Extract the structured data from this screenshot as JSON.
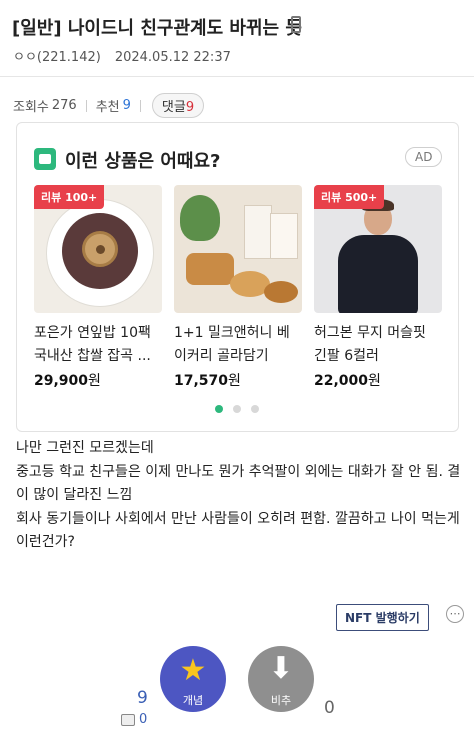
{
  "post": {
    "title": "[일반] 나이드니 친구관계도 바뀌는 듯",
    "author": "ㅇㅇ(221.142)",
    "date": "2024.05.12 22:37",
    "views_label": "조회수",
    "views": "276",
    "recommend_label": "추천",
    "recommend": "9",
    "comments_label": "댓글",
    "comments": "9",
    "body": [
      "나만 그런진 모르겠는데",
      "중고등 학교 친구들은 이제 만나도 뭔가 추억팔이 외에는 대화가 잘 안 됨. 결이 많이 달라진 느낌",
      "회사 동기들이나 사회에서 만난 사람들이 오히려 편함. 깔끔하고 나이 먹는게 이런건가?"
    ]
  },
  "ad": {
    "heading": "이런 상품은 어때요?",
    "tag": "AD",
    "products": [
      {
        "badge": "리뷰 100+",
        "name": "포은가 연잎밥 10팩 국내산 찹쌀 잡곡 ...",
        "price": "29,900",
        "unit": "원"
      },
      {
        "badge": "",
        "name": "1+1 밀크앤허니 베이커리 골라담기",
        "price": "17,570",
        "unit": "원"
      },
      {
        "badge": "리뷰 500+",
        "name": "허그본 무지 머슬핏 긴팔 6컬러",
        "price": "22,000",
        "unit": "원"
      }
    ],
    "active_page": 1,
    "pages": 3
  },
  "actions": {
    "nft_label": "NFT 발행하기",
    "up_label": "개념",
    "down_label": "비추",
    "up_count": "9",
    "up_sub_count": "0",
    "down_count": "0"
  },
  "colors": {
    "accent_blue": "#4d56c2",
    "badge_red": "#e8404a",
    "active_dot": "#2db87d",
    "star": "#f9c51e"
  },
  "icons": [
    "mobile-icon",
    "store-logo-icon",
    "share-icon",
    "star-icon",
    "down-arrow-icon",
    "comment-icon"
  ]
}
